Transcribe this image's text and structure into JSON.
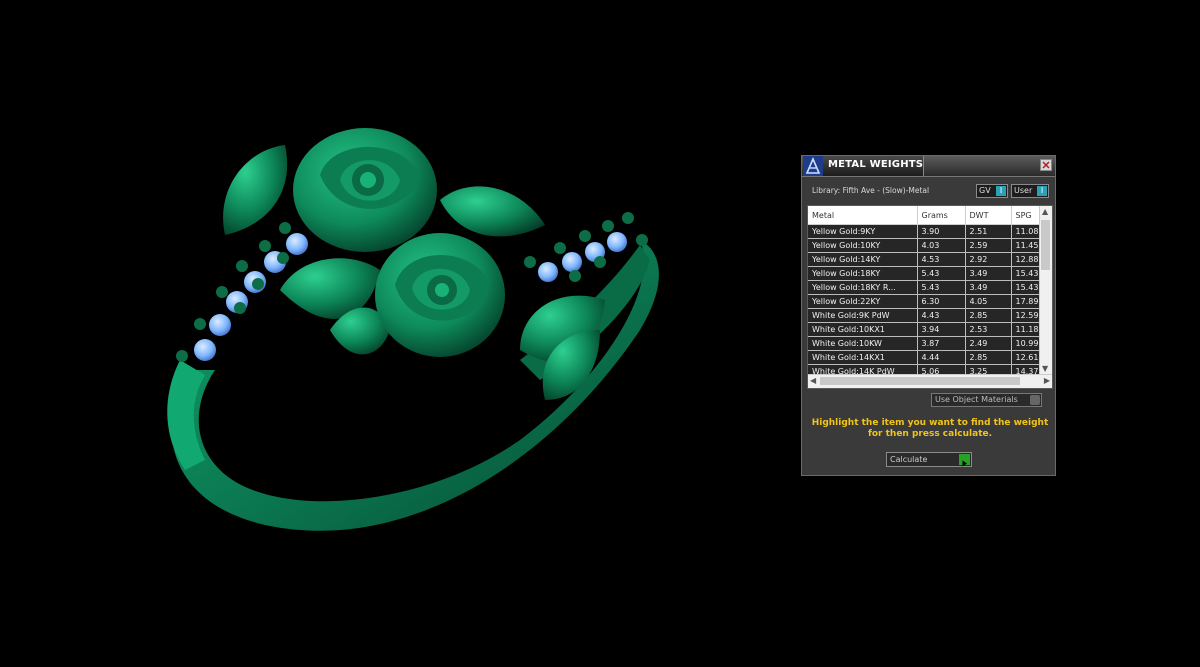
{
  "viewport": {
    "description_icon": "flower-ring-3d-model"
  },
  "panel": {
    "title": "METAL WEIGHTS",
    "library_label": "Library: Fifth Ave - (Slow)-Metal",
    "gv_label": "GV",
    "user_label": "User",
    "toggle_indicator": "I",
    "table": {
      "columns": [
        "Metal",
        "Grams",
        "DWT",
        "SPG"
      ],
      "rows": [
        [
          "Yellow Gold:9KY",
          "3.90",
          "2.51",
          "11.08"
        ],
        [
          "Yellow Gold:10KY",
          "4.03",
          "2.59",
          "11.45"
        ],
        [
          "Yellow Gold:14KY",
          "4.53",
          "2.92",
          "12.88"
        ],
        [
          "Yellow Gold:18KY",
          "5.43",
          "3.49",
          "15.43"
        ],
        [
          "Yellow Gold:18KY R...",
          "5.43",
          "3.49",
          "15.43"
        ],
        [
          "Yellow Gold:22KY",
          "6.30",
          "4.05",
          "17.89"
        ],
        [
          "White Gold:9K PdW",
          "4.43",
          "2.85",
          "12.59"
        ],
        [
          "White Gold:10KX1",
          "3.94",
          "2.53",
          "11.18"
        ],
        [
          "White Gold:10KW",
          "3.87",
          "2.49",
          "10.99"
        ],
        [
          "White Gold:14KX1",
          "4.44",
          "2.85",
          "12.61"
        ],
        [
          "White Gold:14K PdW",
          "5.06",
          "3.25",
          "14.37"
        ]
      ]
    },
    "use_materials_label": "Use Object Materials",
    "instructions": "Highlight the item you want to find the weight for then press calculate.",
    "calculate_label": "Calculate",
    "colors": {
      "instructions": "#f0c419",
      "model_green": "#0f8a5a",
      "stones": "#7fb6ff"
    }
  }
}
